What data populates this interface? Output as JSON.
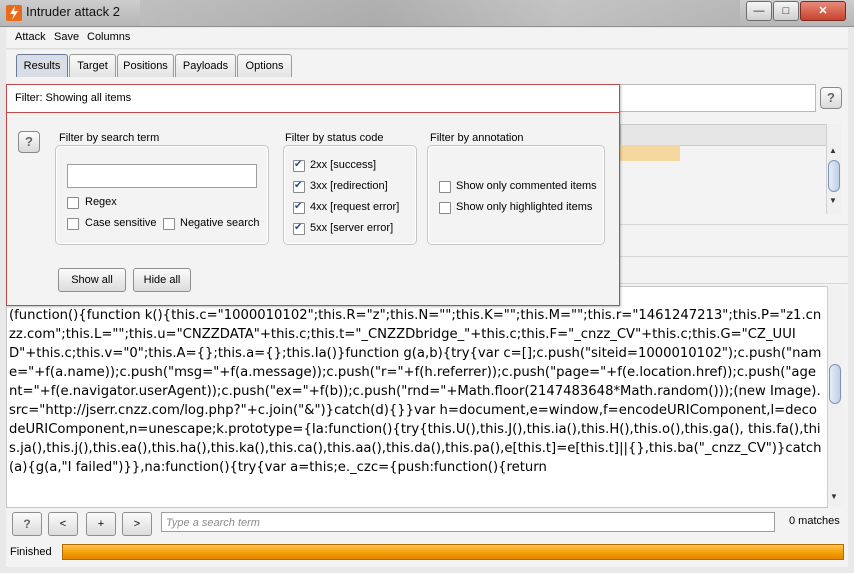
{
  "window": {
    "title": "Intruder attack 2",
    "controls": {
      "minimize": "—",
      "maximize": "□",
      "close": "✕"
    }
  },
  "menu": [
    "Attack",
    "Save",
    "Columns"
  ],
  "tabs": [
    {
      "label": "Results",
      "active": true
    },
    {
      "label": "Target",
      "active": false
    },
    {
      "label": "Positions",
      "active": false
    },
    {
      "label": "Payloads",
      "active": false
    },
    {
      "label": "Options",
      "active": false
    }
  ],
  "filter": {
    "summary": "Filter:  Showing all items",
    "help_glyph": "?",
    "search_term": {
      "title": "Filter by search term",
      "value": "",
      "regex_label": "Regex",
      "regex_checked": false,
      "case_sensitive_label": "Case sensitive",
      "case_sensitive_checked": false,
      "negative_label": "Negative search",
      "negative_checked": false
    },
    "status_code": {
      "title": "Filter by status code",
      "items": [
        {
          "label": "2xx  [success]",
          "checked": true
        },
        {
          "label": "3xx  [redirection]",
          "checked": true
        },
        {
          "label": "4xx  [request error]",
          "checked": true
        },
        {
          "label": "5xx  [server error]",
          "checked": true
        }
      ]
    },
    "annotation": {
      "title": "Filter by annotation",
      "commented_label": "Show only commented items",
      "commented_checked": false,
      "highlighted_label": "Show only highlighted items",
      "highlighted_checked": false
    },
    "show_all": "Show all",
    "hide_all": "Hide all"
  },
  "response": {
    "text": "(function(){function k(){this.c=\"1000010102\";this.R=\"z\";this.N=\"\";this.K=\"\";this.M=\"\";this.r=\"1461247213\";this.P=\"z1.cnzz.com\";this.L=\"\";this.u=\"CNZZDATA\"+this.c;this.t=\"_CNZZDbridge_\"+this.c;this.F=\"_cnzz_CV\"+this.c;this.G=\"CZ_UUID\"+this.c;this.v=\"0\";this.A={};this.a={};this.Ia()}function g(a,b){try{var c=[];c.push(\"siteid=1000010102\");c.push(\"name=\"+f(a.name));c.push(\"msg=\"+f(a.message));c.push(\"r=\"+f(h.referrer));c.push(\"page=\"+f(e.location.href));c.push(\"agent=\"+f(e.navigator.userAgent));c.push(\"ex=\"+f(b));c.push(\"rnd=\"+Math.floor(2147483648*Math.random()));(new Image).src=\"http://jserr.cnzz.com/log.php?\"+c.join(\"&\")}catch(d){}}var h=document,e=window,f=encodeURIComponent,l=decodeURIComponent,n=unescape;k.prototype={Ia:function(){try{this.U(),this.J(),this.ia(),this.H(),this.o(),this.ga(), this.fa(),this.ja(),this.j(),this.ea(),this.ha(),this.ka(),this.ca(),this.aa(),this.da(),this.pa(),e[this.t]=e[this.t]||{},this.ba(\"_cnzz_CV\")}catch(a){g(a,\"I failed\")}},na:function(){try{var a=this;e._czc={push:function(){return"
  },
  "search": {
    "help": "?",
    "prev": "<",
    "add": "+",
    "next": ">",
    "placeholder": "Type a search term",
    "matches": "0 matches"
  },
  "status": {
    "text": "Finished",
    "progress": 1.0
  },
  "colors": {
    "progress": "#f39a00",
    "popup_border": "#c04a4a",
    "active_tab": "#d9dde6"
  }
}
